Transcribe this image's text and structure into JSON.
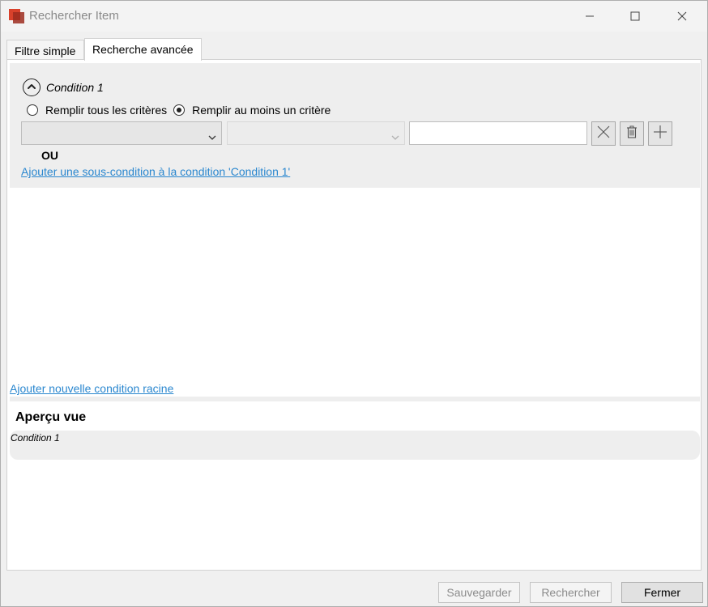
{
  "window": {
    "title": "Rechercher Item",
    "controls": [
      "minimize-icon",
      "maximize-icon",
      "close-icon"
    ]
  },
  "tabs": [
    {
      "label": "Filtre simple",
      "active": false
    },
    {
      "label": "Recherche avancée",
      "active": true
    }
  ],
  "condition": {
    "title": "Condition 1",
    "collapse_icon": "chevron-up-icon",
    "radio_all_label": "Remplir tous les critères",
    "radio_any_label": "Remplir au moins un critère",
    "selected_mode": "any",
    "field_select_value": "",
    "operator_select_value": "",
    "criteria_value": "",
    "action_icons": [
      "close-icon",
      "trash-icon",
      "plus-icon"
    ],
    "logic_label": "OU",
    "add_subcondition_link": "Ajouter une sous-condition à la condition 'Condition 1'"
  },
  "add_root_link": "Ajouter nouvelle condition racine",
  "preview": {
    "title": "Aperçu vue",
    "text": "Condition 1"
  },
  "footer": {
    "save_label": "Sauvegarder",
    "search_label": "Rechercher",
    "close_label": "Fermer"
  },
  "colors": {
    "link": "#2a87cf",
    "condition_bg": "#eeeeee",
    "app_icon": "#d9412b"
  }
}
